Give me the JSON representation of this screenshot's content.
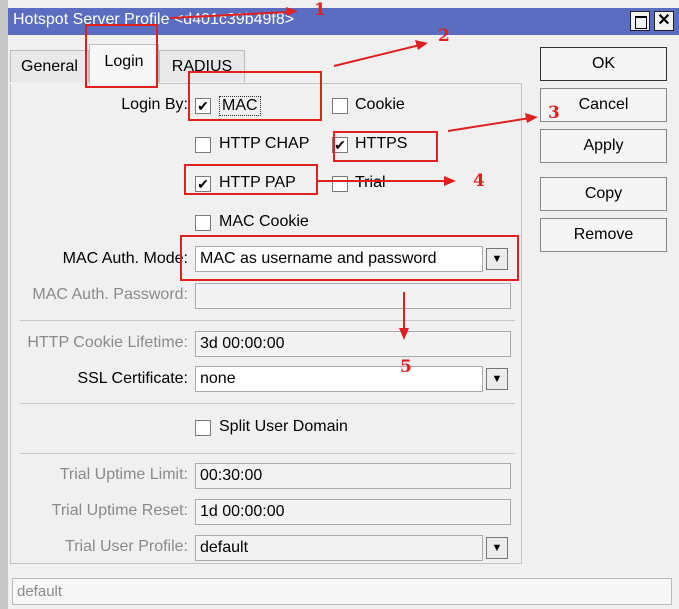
{
  "window": {
    "title": "Hotspot Server Profile <d401c39b49f8>",
    "restore_glyph": "",
    "close_glyph": "✕"
  },
  "tabs": [
    "General",
    "Login",
    "RADIUS"
  ],
  "login": {
    "login_by_label": "Login By:",
    "options": [
      {
        "label": "MAC",
        "checked": true
      },
      {
        "label": "Cookie",
        "checked": false
      },
      {
        "label": "HTTP CHAP",
        "checked": false
      },
      {
        "label": "HTTPS",
        "checked": true
      },
      {
        "label": "HTTP PAP",
        "checked": true
      },
      {
        "label": "Trial",
        "checked": false
      },
      {
        "label": "MAC Cookie",
        "checked": false
      }
    ],
    "mac_auth_mode_label": "MAC Auth. Mode:",
    "mac_auth_mode_value": "MAC as username and password",
    "mac_auth_password_label": "MAC Auth. Password:",
    "mac_auth_password_value": "",
    "http_cookie_lifetime_label": "HTTP Cookie Lifetime:",
    "http_cookie_lifetime_value": "3d 00:00:00",
    "ssl_certificate_label": "SSL Certificate:",
    "ssl_certificate_value": "none",
    "split_user_domain_label": "Split User Domain",
    "split_user_domain_checked": false,
    "trial_uptime_limit_label": "Trial Uptime Limit:",
    "trial_uptime_limit_value": "00:30:00",
    "trial_uptime_reset_label": "Trial Uptime Reset:",
    "trial_uptime_reset_value": "1d 00:00:00",
    "trial_user_profile_label": "Trial User Profile:",
    "trial_user_profile_value": "default"
  },
  "buttons": {
    "ok": "OK",
    "cancel": "Cancel",
    "apply": "Apply",
    "copy": "Copy",
    "remove": "Remove"
  },
  "status": "default",
  "annotations": [
    "1",
    "2",
    "3",
    "4",
    "5"
  ],
  "icons": {
    "dropdown": "▼",
    "check": "✔"
  },
  "colors": {
    "titlebar": "#5b6dc1",
    "annotation": "#e02020"
  }
}
